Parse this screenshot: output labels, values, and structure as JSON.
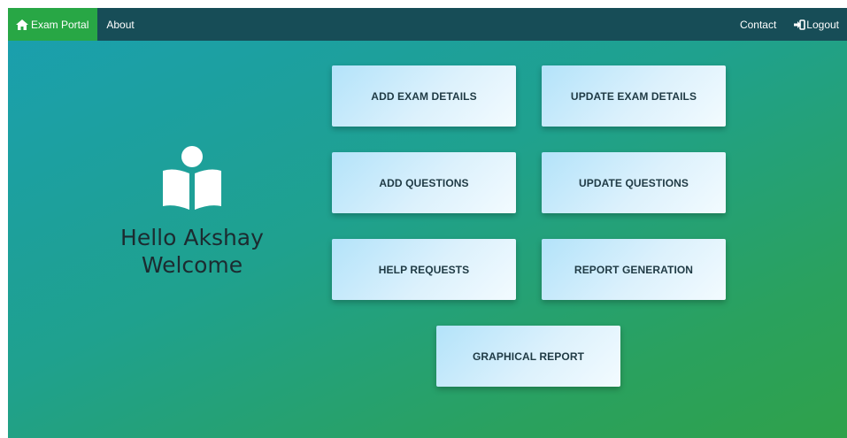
{
  "nav": {
    "brand_label": "Exam Portal",
    "about_label": "About",
    "contact_label": "Contact",
    "logout_label": "Logout"
  },
  "welcome": {
    "line1": "Hello Akshay",
    "line2": "Welcome",
    "icon": "reader-icon"
  },
  "tiles": {
    "add_exam": "ADD EXAM DETAILS",
    "update_exam": "UPDATE EXAM DETAILS",
    "add_questions": "ADD QUESTIONS",
    "update_questions": "UPDATE QUESTIONS",
    "help_requests": "HELP REQUESTS",
    "report_generation": "REPORT GENERATION",
    "graphical_report": "GRAPHICAL REPORT"
  },
  "colors": {
    "navbar": "#174d57",
    "brand": "#28a745",
    "tile_start": "#b3e3fa",
    "tile_end": "#f3fbff"
  }
}
